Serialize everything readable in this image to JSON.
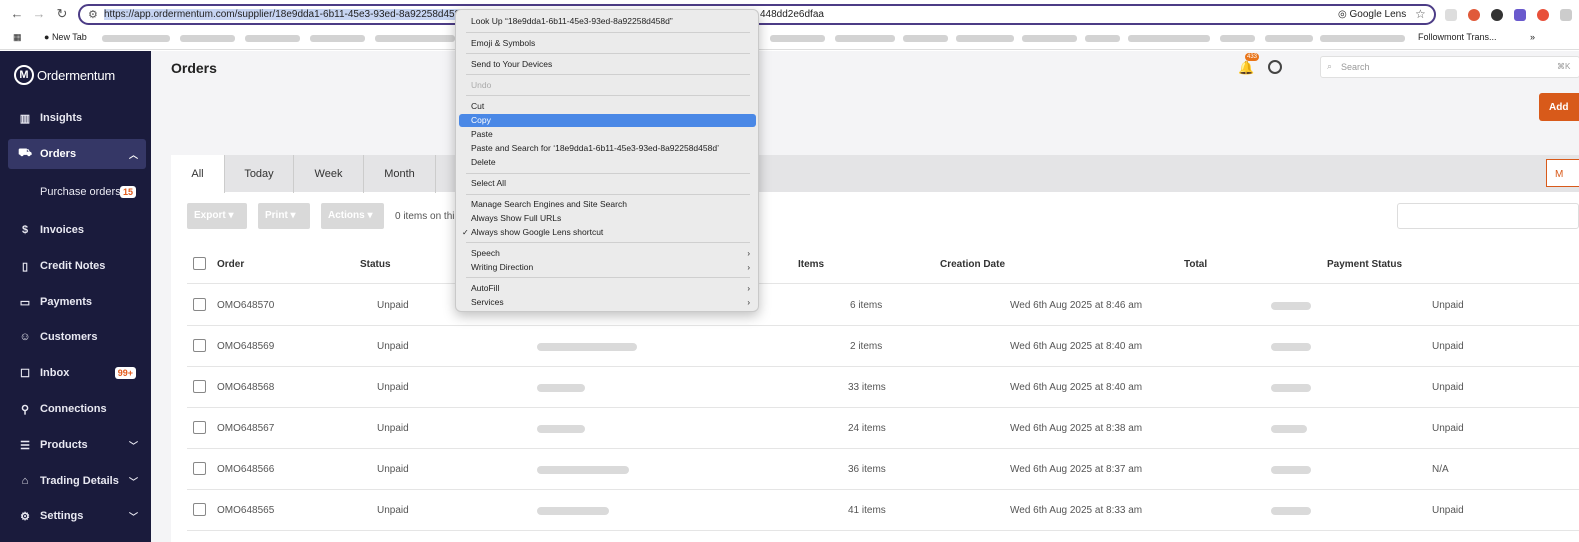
{
  "browser": {
    "url_selected": "https://app.ordermentum.com/supplier/18e9dda1-6b11-45e3-93ed-8a92258d458",
    "url_tail": "448dd2e6dfaa",
    "lens_label": "Google Lens",
    "new_tab_label": "New Tab",
    "followmont_label": "Followmont Trans...",
    "more_bookmarks": "»"
  },
  "sidebar": {
    "logo": "Ordermentum",
    "logo_letter": "M",
    "items": [
      {
        "label": "Insights",
        "icon": "chart-icon"
      },
      {
        "label": "Orders",
        "icon": "cart-icon"
      },
      {
        "label": "Purchase orders",
        "badge": "15"
      },
      {
        "label": "Invoices",
        "icon": "dollar-icon"
      },
      {
        "label": "Credit Notes",
        "icon": "document-icon"
      },
      {
        "label": "Payments",
        "icon": "card-icon"
      },
      {
        "label": "Customers",
        "icon": "users-icon"
      },
      {
        "label": "Inbox",
        "icon": "message-icon",
        "badge": "99+"
      },
      {
        "label": "Connections",
        "icon": "connection-icon"
      },
      {
        "label": "Products",
        "icon": "list-icon"
      },
      {
        "label": "Trading Details",
        "icon": "tag-icon"
      },
      {
        "label": "Settings",
        "icon": "gear-icon"
      }
    ]
  },
  "header": {
    "title": "Orders",
    "notification_count": "433",
    "search_placeholder": "Search",
    "search_shortcut": "⌘K",
    "add_button": "Add"
  },
  "tabs": [
    "All",
    "Today",
    "Week",
    "Month"
  ],
  "tab_right_label": "M",
  "toolbar": {
    "export": "Export",
    "print": "Print",
    "actions": "Actions",
    "items_selected": "0 items on thi"
  },
  "columns": [
    "Order",
    "Status",
    "Items",
    "Creation Date",
    "Total",
    "Payment Status"
  ],
  "rows": [
    {
      "order": "OMO648570",
      "status": "Unpaid",
      "items": "6 items",
      "date": "Wed 6th Aug 2025 at 8:46 am",
      "payment": "Unpaid"
    },
    {
      "order": "OMO648569",
      "status": "Unpaid",
      "items": "2 items",
      "date": "Wed 6th Aug 2025 at 8:40 am",
      "payment": "Unpaid"
    },
    {
      "order": "OMO648568",
      "status": "Unpaid",
      "items": "33 items",
      "date": "Wed 6th Aug 2025 at 8:40 am",
      "payment": "Unpaid"
    },
    {
      "order": "OMO648567",
      "status": "Unpaid",
      "items": "24 items",
      "date": "Wed 6th Aug 2025 at 8:38 am",
      "payment": "Unpaid"
    },
    {
      "order": "OMO648566",
      "status": "Unpaid",
      "items": "36 items",
      "date": "Wed 6th Aug 2025 at 8:37 am",
      "payment": "N/A"
    },
    {
      "order": "OMO648565",
      "status": "Unpaid",
      "items": "41 items",
      "date": "Wed 6th Aug 2025 at 8:33 am",
      "payment": "Unpaid"
    }
  ],
  "context_menu": {
    "look_up": "Look Up “18e9dda1-6b11-45e3-93ed-8a92258d458d”",
    "emoji": "Emoji & Symbols",
    "send": "Send to Your Devices",
    "undo": "Undo",
    "cut": "Cut",
    "copy": "Copy",
    "paste": "Paste",
    "paste_search": "Paste and Search for ‘18e9dda1-6b11-45e3-93ed-8a92258d458d’",
    "delete": "Delete",
    "select_all": "Select All",
    "manage": "Manage Search Engines and Site Search",
    "show_urls": "Always Show Full URLs",
    "lens_shortcut": "Always show Google Lens shortcut",
    "speech": "Speech",
    "writing": "Writing Direction",
    "autofill": "AutoFill",
    "services": "Services"
  }
}
